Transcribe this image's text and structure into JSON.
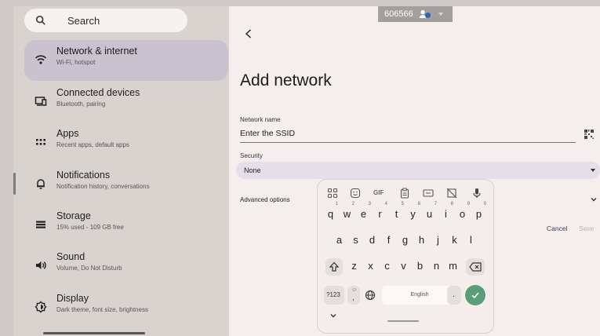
{
  "sidebar": {
    "search_placeholder": "Search",
    "items": [
      {
        "title": "Network & internet",
        "subtitle": "Wi-Fi, hotspot",
        "icon": "wifi-icon"
      },
      {
        "title": "Connected devices",
        "subtitle": "Bluetooth, pairing",
        "icon": "connected-devices-icon"
      },
      {
        "title": "Apps",
        "subtitle": "Recent apps, default apps",
        "icon": "apps-grid-icon"
      },
      {
        "title": "Notifications",
        "subtitle": "Notification history, conversations",
        "icon": "bell-icon"
      },
      {
        "title": "Storage",
        "subtitle": "15% used - 109 GB free",
        "icon": "storage-icon"
      },
      {
        "title": "Sound",
        "subtitle": "Volume, Do Not Disturb",
        "icon": "volume-icon"
      },
      {
        "title": "Display",
        "subtitle": "Dark theme, font size, brightness",
        "icon": "brightness-icon"
      }
    ]
  },
  "main": {
    "title": "Add network",
    "network_name_label": "Network name",
    "network_name_value": "Enter the SSID",
    "security_label": "Security",
    "security_value": "None",
    "advanced_options": "Advanced options",
    "cancel": "Cancel",
    "save": "Save"
  },
  "toast": {
    "number": "606566"
  },
  "keyboard": {
    "row1": [
      "q",
      "w",
      "e",
      "r",
      "t",
      "y",
      "u",
      "i",
      "o",
      "p"
    ],
    "row1_hints": [
      "1",
      "2",
      "3",
      "4",
      "5",
      "6",
      "7",
      "8",
      "9",
      "0"
    ],
    "row2": [
      "a",
      "s",
      "d",
      "f",
      "g",
      "h",
      "j",
      "k",
      "l"
    ],
    "row3": [
      "z",
      "x",
      "c",
      "v",
      "b",
      "n",
      "m"
    ],
    "symbols_key": "?123",
    "space_label": "English",
    "period": ".",
    "gif_label": "GIF"
  },
  "colors": {
    "accent": "#5a9d79",
    "selected": "#c9c3cf"
  }
}
